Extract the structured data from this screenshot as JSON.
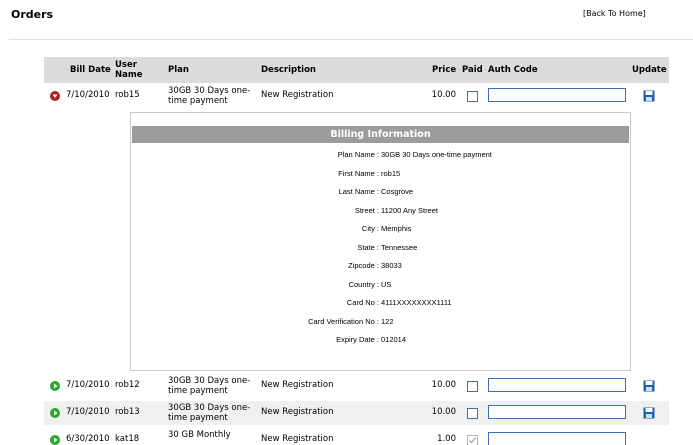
{
  "page": {
    "title": "Orders",
    "back_link": "[Back To Home]"
  },
  "columns": {
    "bill_date": "Bill Date",
    "user_name_1": "User",
    "user_name_2": "Name",
    "plan": "Plan",
    "description": "Description",
    "price": "Price",
    "paid": "Paid",
    "auth_code": "Auth Code",
    "update": "Update"
  },
  "orders": [
    {
      "bill_date": "7/10/2010",
      "user_name": "rob15",
      "plan": "30GB 30 Days one-time payment",
      "description": "New Registration",
      "price": "10.00",
      "paid": false,
      "auth_code": "",
      "expanded": true
    },
    {
      "bill_date": "7/10/2010",
      "user_name": "rob12",
      "plan": "30GB 30 Days one-time payment",
      "description": "New Registration",
      "price": "10.00",
      "paid": false,
      "auth_code": "",
      "expanded": false
    },
    {
      "bill_date": "7/10/2010",
      "user_name": "rob13",
      "plan": "30GB 30 Days one-time payment",
      "description": "New Registration",
      "price": "10.00",
      "paid": false,
      "auth_code": "",
      "expanded": false
    },
    {
      "bill_date": "6/30/2010",
      "user_name": "kat18",
      "plan": "30 GB Monthly",
      "description": "New Registration",
      "price": "1.00",
      "paid": true,
      "auth_code": "",
      "expanded": false
    }
  ],
  "billing": {
    "heading": "Billing Information",
    "fields": [
      {
        "label": "Plan Name :",
        "value": "30GB 30 Days one-time payment"
      },
      {
        "label": "First Name :",
        "value": "rob15"
      },
      {
        "label": "Last Name :",
        "value": "Cosgrove"
      },
      {
        "label": "Street :",
        "value": "11200 Any Street"
      },
      {
        "label": "City :",
        "value": "Memphis"
      },
      {
        "label": "State :",
        "value": "Tennessee"
      },
      {
        "label": "Zipcode :",
        "value": "38033"
      },
      {
        "label": "Country :",
        "value": "US"
      },
      {
        "label": "Card No :",
        "value": "4111XXXXXXXX1111"
      },
      {
        "label": "Card Verification No :",
        "value": "122"
      },
      {
        "label": "Expiry Date :",
        "value": "012014"
      }
    ]
  },
  "colors": {
    "header_bg": "#dcdcdc",
    "billing_header_bg": "#9c9c9c",
    "expand_open": "#b11f1f",
    "expand_closed": "#28a928",
    "input_border": "#3f6db3",
    "save_icon": "#1f5fae"
  },
  "icons": {
    "collapse": "collapse-arrow-icon",
    "expand": "expand-arrow-icon",
    "save": "floppy-disk-icon"
  }
}
